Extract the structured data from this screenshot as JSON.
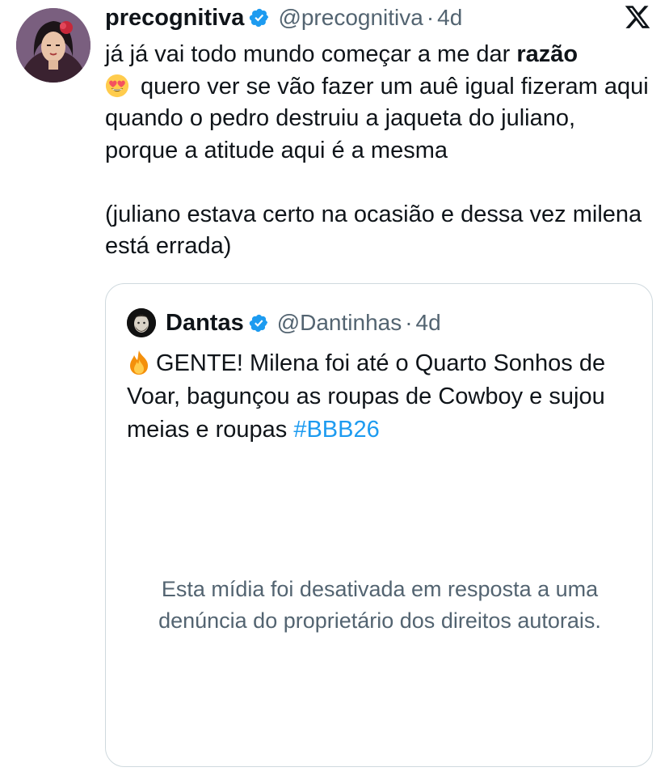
{
  "tweet": {
    "display_name": "precognitiva",
    "handle": "@precognitiva",
    "separator": "·",
    "time": "4d",
    "text_part1": "já já vai todo mundo começar a me dar ",
    "text_bold": "razão",
    "text_part2": "quero ver se vão fazer um auê igual fizeram aqui quando o pedro destruiu a jaqueta do juliano, porque a atitude aqui é a mesma",
    "text_paragraph2": "(juliano estava certo na ocasião e dessa vez milena está errada)",
    "emoji": "heart-eyes-emoji"
  },
  "quote": {
    "display_name": "Dantas",
    "handle": "@Dantinhas",
    "separator": "·",
    "time": "4d",
    "text_main": "GENTE! Milena foi até o Quarto Sonhos de Voar, bagunçou as roupas de Cowboy e sujou meias e roupas ",
    "hashtag": "#BBB26",
    "media_notice": "Esta mídia foi desativada em resposta a uma denúncia do proprietário dos direitos autorais."
  },
  "colors": {
    "text_primary": "#0f1419",
    "text_secondary": "#536471",
    "link": "#1d9bf0",
    "verified": "#1d9bf0",
    "border": "#cfd9de"
  },
  "icons": {
    "verified": "verified-badge-icon",
    "logo": "x-logo-icon",
    "fire": "fire-emoji"
  }
}
